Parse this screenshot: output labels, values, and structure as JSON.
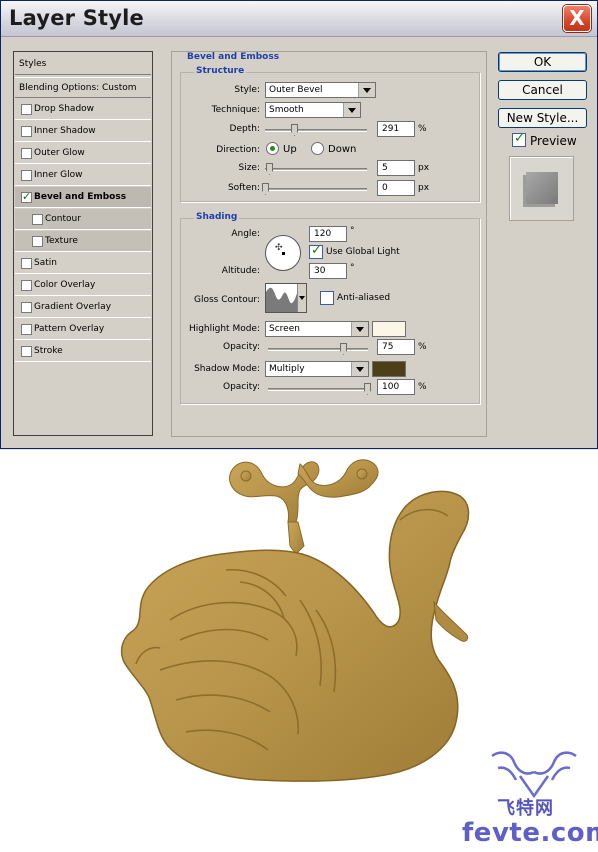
{
  "window": {
    "title": "Layer Style",
    "close_glyph": "X"
  },
  "styles_list": {
    "header": "Styles",
    "blending": "Blending Options: Custom",
    "items": [
      {
        "label": "Drop Shadow",
        "checked": false
      },
      {
        "label": "Inner Shadow",
        "checked": false
      },
      {
        "label": "Outer Glow",
        "checked": false
      },
      {
        "label": "Inner Glow",
        "checked": false
      },
      {
        "label": "Bevel and Emboss",
        "checked": true,
        "selected": true
      },
      {
        "label": "Contour",
        "checked": false,
        "sub": true
      },
      {
        "label": "Texture",
        "checked": false,
        "sub": true
      },
      {
        "label": "Satin",
        "checked": false
      },
      {
        "label": "Color Overlay",
        "checked": false
      },
      {
        "label": "Gradient Overlay",
        "checked": false
      },
      {
        "label": "Pattern Overlay",
        "checked": false
      },
      {
        "label": "Stroke",
        "checked": false
      }
    ]
  },
  "bevel": {
    "section_title": "Bevel and Emboss",
    "structure_title": "Structure",
    "style_label": "Style:",
    "style_value": "Outer Bevel",
    "technique_label": "Technique:",
    "technique_value": "Smooth",
    "depth_label": "Depth:",
    "depth_value": "291",
    "depth_unit": "%",
    "direction_label": "Direction:",
    "direction_up": "Up",
    "direction_down": "Down",
    "direction_selected": "Up",
    "size_label": "Size:",
    "size_value": "5",
    "size_unit": "px",
    "soften_label": "Soften:",
    "soften_value": "0",
    "soften_unit": "px"
  },
  "shading": {
    "title": "Shading",
    "angle_label": "Angle:",
    "angle_value": "120",
    "angle_unit": "°",
    "global_light_label": "Use Global Light",
    "global_light": true,
    "altitude_label": "Altitude:",
    "altitude_value": "30",
    "altitude_unit": "°",
    "gloss_label": "Gloss Contour:",
    "anti_aliased_label": "Anti-aliased",
    "anti_aliased": false,
    "highlight_mode_label": "Highlight Mode:",
    "highlight_mode": "Screen",
    "highlight_color": "#fbf6e6",
    "highlight_opacity_label": "Opacity:",
    "highlight_opacity": "75",
    "highlight_opacity_unit": "%",
    "shadow_mode_label": "Shadow Mode:",
    "shadow_mode": "Multiply",
    "shadow_color": "#4d4019",
    "shadow_opacity_label": "Opacity:",
    "shadow_opacity": "100",
    "shadow_opacity_unit": "%"
  },
  "buttons": {
    "ok": "OK",
    "cancel": "Cancel",
    "new_style": "New Style...",
    "preview": "Preview",
    "preview_checked": true
  },
  "canvas": {
    "subject_color": "#b8954a",
    "watermark_cn": "飞特网",
    "watermark": "fevte.com",
    "watermark_color": "#5f5fc8"
  }
}
